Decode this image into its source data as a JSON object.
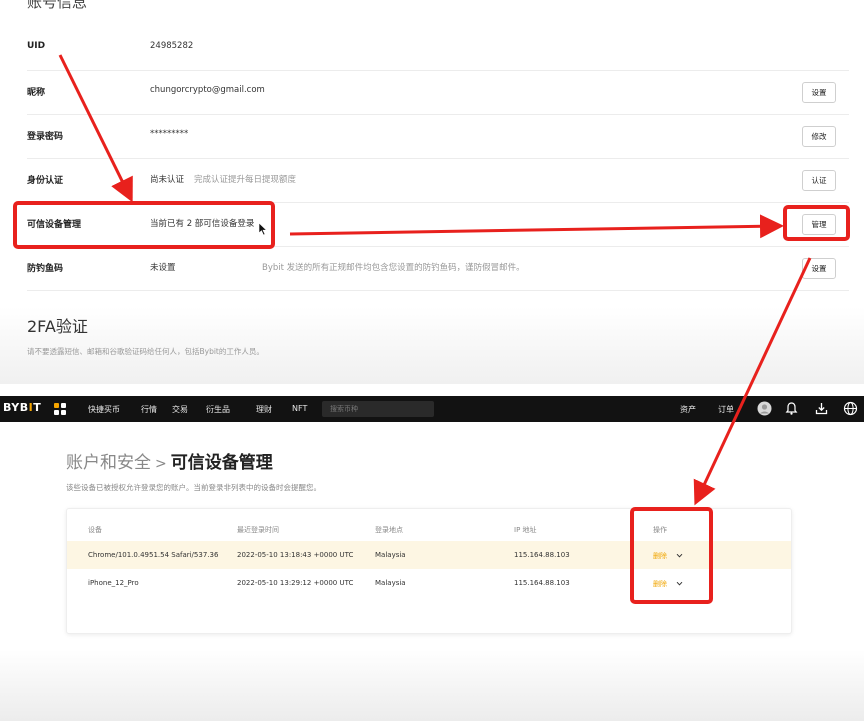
{
  "account": {
    "section_title": "账号信息",
    "rows": [
      {
        "label": "UID",
        "value": "24985282",
        "hint": "",
        "button": ""
      },
      {
        "label": "昵称",
        "value": "chungorcrypto@gmail.com",
        "hint": "",
        "button": "设置"
      },
      {
        "label": "登录密码",
        "value": "*********",
        "hint": "",
        "button": "修改"
      },
      {
        "label": "身份认证",
        "value": "尚未认证",
        "hint": "完成认证提升每日提现额度",
        "button": "认证"
      },
      {
        "label": "可信设备管理",
        "value": "当前已有 2 部可信设备登录",
        "hint": "",
        "button": "管理"
      },
      {
        "label": "防钓鱼码",
        "value": "未设置",
        "hint": "Bybit 发送的所有正规邮件均包含您设置的防钓鱼码，谨防假冒邮件。",
        "button": "设置"
      }
    ],
    "twofa_title": "2FA验证",
    "twofa_desc": "请不要透露短信、邮箱和谷歌验证码给任何人，包括Bybit的工作人员。"
  },
  "navbar": {
    "logo_main": "BYB",
    "logo_accent": "I",
    "logo_tail": "T",
    "items": [
      "快捷买币",
      "行情",
      "交易",
      "衍生品",
      "理财",
      "NFT"
    ],
    "search_placeholder": "搜索币种",
    "assets": "资产",
    "orders": "订单",
    "icons": [
      "user-avatar-icon",
      "bell-icon",
      "download-icon",
      "globe-icon"
    ]
  },
  "page": {
    "breadcrumb_parent": "账户和安全",
    "breadcrumb_sep": ">",
    "title": "可信设备管理",
    "description": "该些设备已被授权允许登录您的账户。当前登录非列表中的设备时会提醒您。"
  },
  "devices_table": {
    "headers": [
      "设备",
      "最近登录时间",
      "登录地点",
      "IP 地址",
      "操作"
    ],
    "rows": [
      {
        "device": "Chrome/101.0.4951.54 Safari/537.36",
        "time": "2022-05-10 13:18:43 +0000 UTC",
        "location": "Malaysia",
        "ip": "115.164.88.103",
        "action": "删除"
      },
      {
        "device": "iPhone_12_Pro",
        "time": "2022-05-10 13:29:12 +0000 UTC",
        "location": "Malaysia",
        "ip": "115.164.88.103",
        "action": "删除"
      }
    ]
  },
  "colors": {
    "annotation_red": "#e8211d",
    "brand_accent": "#f7a600",
    "navbar_bg": "#121212",
    "row_highlight": "#fdf6e3"
  }
}
